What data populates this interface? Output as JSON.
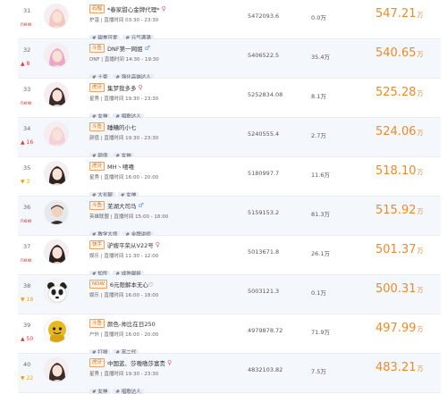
{
  "colors": {
    "accent": "#f08a24",
    "rank_up": "#e53935",
    "rank_down": "#f0a400",
    "tag_bg": "#e9eef5"
  },
  "rows": [
    {
      "rank": "31",
      "change": "new",
      "change_type": "new",
      "platform": "石榴",
      "name": "*春家甜心金牌代理*",
      "gender": "♀",
      "gender_type": "female",
      "meta": "炉温 | 直播时间 03:30 - 23:30",
      "tags": [
        "# 甜美可爱",
        "# 元气满满"
      ],
      "followers": "5472093.6",
      "gift": "0.0万",
      "value": "547.21",
      "unit": "万",
      "avatar_icon": "female-avatar-icon",
      "avatar_color": "#f2c7c2"
    },
    {
      "rank": "32",
      "change": "▲ 8",
      "change_type": "up",
      "platform": "斗鱼",
      "name": "DNF第一网姐",
      "gender": "♂",
      "gender_type": "male",
      "meta": "DNF | 直播时间 14:30 - 19:30",
      "tags": [
        "# 土豪",
        "# 强化高端达人"
      ],
      "followers": "5406522.5",
      "gift": "35.4万",
      "value": "540.65",
      "unit": "万",
      "avatar_icon": "female-avatar-icon",
      "avatar_color": "#e8a8c8"
    },
    {
      "rank": "33",
      "change": "new",
      "change_type": "new",
      "platform": "虎牙",
      "name": "集梦我多多",
      "gender": "♀",
      "gender_type": "female",
      "meta": "星秀 | 直播时间 19:30 - 23:30",
      "tags": [
        "# 女神",
        "# 唱歌达人"
      ],
      "followers": "5252834.08",
      "gift": "8.1万",
      "value": "525.28",
      "unit": "万",
      "avatar_icon": "female-avatar-icon",
      "avatar_color": "#3a2a2a"
    },
    {
      "rank": "34",
      "change": "▲ 16",
      "change_type": "up",
      "platform": "斗鱼",
      "name": "睡糟的小七",
      "gender": "",
      "gender_type": "female",
      "meta": "颜值 | 直播时间 19:30 - 23:30",
      "tags": [
        "# 颜值",
        "# 女神"
      ],
      "followers": "5240555.4",
      "gift": "2.7万",
      "value": "524.06",
      "unit": "万",
      "avatar_icon": "female-avatar-icon",
      "avatar_color": "#f4d0dc"
    },
    {
      "rank": "35",
      "change": "▼ 3",
      "change_type": "down",
      "platform": "虎牙",
      "name": "MH丶嘻嘻",
      "gender": "",
      "gender_type": "female",
      "meta": "星秀 | 直播时间 16:00 - 20:00",
      "tags": [
        "# 大长腿",
        "# 女神"
      ],
      "followers": "5180997.7",
      "gift": "11.6万",
      "value": "518.10",
      "unit": "万",
      "avatar_icon": "female-avatar-icon",
      "avatar_color": "#2d2420"
    },
    {
      "rank": "36",
      "change": "new",
      "change_type": "new",
      "platform": "斗鱼",
      "name": "芜湖大司马",
      "gender": "♂",
      "gender_type": "male",
      "meta": "英雄联盟 | 直播时间 15:00 - 18:00",
      "tags": [
        "# 教学大师",
        "# 金牌讲师"
      ],
      "followers": "5159153.2",
      "gift": "81.3万",
      "value": "515.92",
      "unit": "万",
      "avatar_icon": "male-avatar-icon",
      "avatar_color": "#4a4a50"
    },
    {
      "rank": "37",
      "change": "new",
      "change_type": "new",
      "platform": "快手",
      "name": "驴嫂平荣从V22号",
      "gender": "♀",
      "gender_type": "female",
      "meta": "娱乐 | 直播时间 11:30 - 12:00",
      "tags": [
        "# 知性",
        "# 成熟御姐"
      ],
      "followers": "5013671.8",
      "gift": "26.1万",
      "value": "501.37",
      "unit": "万",
      "avatar_icon": "female-avatar-icon",
      "avatar_color": "#2a2020"
    },
    {
      "rank": "38",
      "change": "▼ 18",
      "change_type": "down",
      "platform": "NOW",
      "name": "6元限解本无心♡",
      "gender": "",
      "gender_type": "female",
      "meta": "娱乐 | 直播时间 16:00 - 18:00",
      "tags": [],
      "followers": "5003121.3",
      "gift": "0.1万",
      "value": "500.31",
      "unit": "万",
      "avatar_icon": "panda-avatar-icon",
      "avatar_color": "#ffffff"
    },
    {
      "rank": "39",
      "change": "▲ 50",
      "change_type": "up",
      "platform": "斗鱼",
      "name": "颜色-帅比在日250",
      "gender": "",
      "gender_type": "male",
      "meta": "户外 | 直播时间 16:00 - 20:00",
      "tags": [
        "# 打嗝",
        "# 富二代"
      ],
      "followers": "4979878.72",
      "gift": "71.9万",
      "value": "497.99",
      "unit": "万",
      "avatar_icon": "gold-mascot-avatar-icon",
      "avatar_color": "#e8b820"
    },
    {
      "rank": "40",
      "change": "▼ 22",
      "change_type": "down",
      "platform": "虎牙",
      "name": "中国蓝、莎嗷嗷莎富贵",
      "gender": "♀",
      "gender_type": "female",
      "meta": "星秀 | 直播时间 19:30 - 23:30",
      "tags": [
        "# 女神",
        "# 唱歌达人"
      ],
      "followers": "4832103.82",
      "gift": "7.5万",
      "value": "483.21",
      "unit": "万",
      "avatar_icon": "female-avatar-icon",
      "avatar_color": "#3a2e2a"
    }
  ]
}
